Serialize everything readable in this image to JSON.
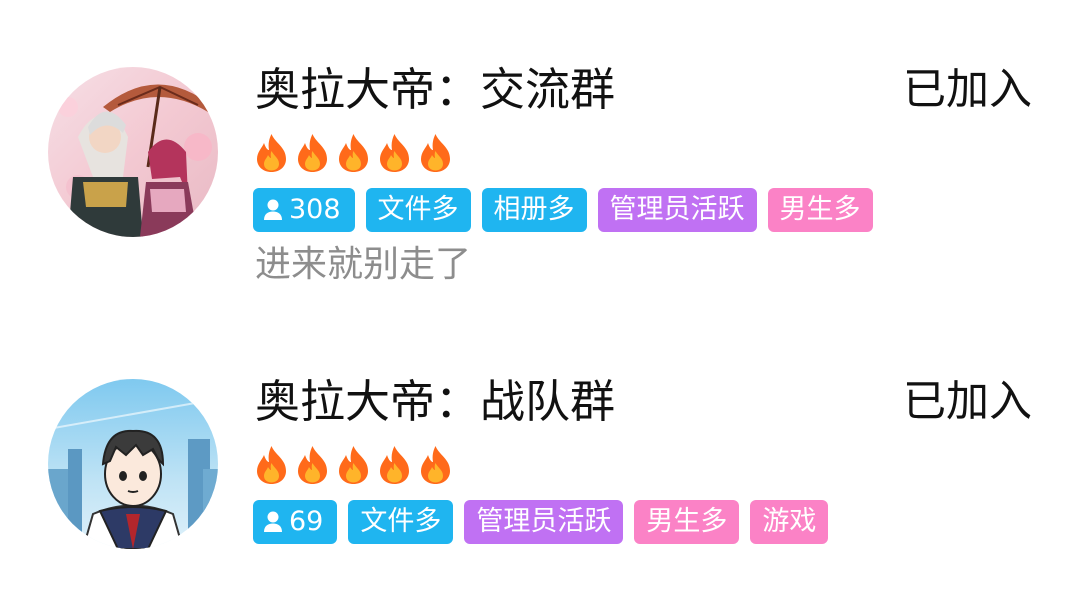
{
  "groups": [
    {
      "title": "奥拉大帝：交流群",
      "status": "已加入",
      "member_count": "308",
      "heat_level": 5,
      "tags": [
        {
          "label": "文件多",
          "color": "#1fb5f0"
        },
        {
          "label": "相册多",
          "color": "#1fb5f0"
        },
        {
          "label": "管理员活跃",
          "color": "#c071f3"
        },
        {
          "label": "男生多",
          "color": "#fb82c6"
        }
      ],
      "description": "进来就别走了",
      "avatar_icon": "anime-characters-avatar"
    },
    {
      "title": "奥拉大帝：战队群",
      "status": "已加入",
      "member_count": "69",
      "heat_level": 5,
      "tags": [
        {
          "label": "文件多",
          "color": "#1fb5f0"
        },
        {
          "label": "管理员活跃",
          "color": "#c071f3"
        },
        {
          "label": "男生多",
          "color": "#fb82c6"
        },
        {
          "label": "游戏",
          "color": "#fb82c6"
        }
      ],
      "avatar_icon": "cartoon-boy-avatar"
    }
  ],
  "colors": {
    "tag_blue": "#1fb5f0",
    "tag_purple": "#c071f3",
    "tag_pink": "#fb82c6",
    "title_text": "#111111",
    "desc_text": "#8d8d8d",
    "flame_outer": "#ff6a1a",
    "flame_inner": "#ffb42a"
  },
  "icons": {
    "flame": "flame-icon",
    "member": "person-icon"
  }
}
